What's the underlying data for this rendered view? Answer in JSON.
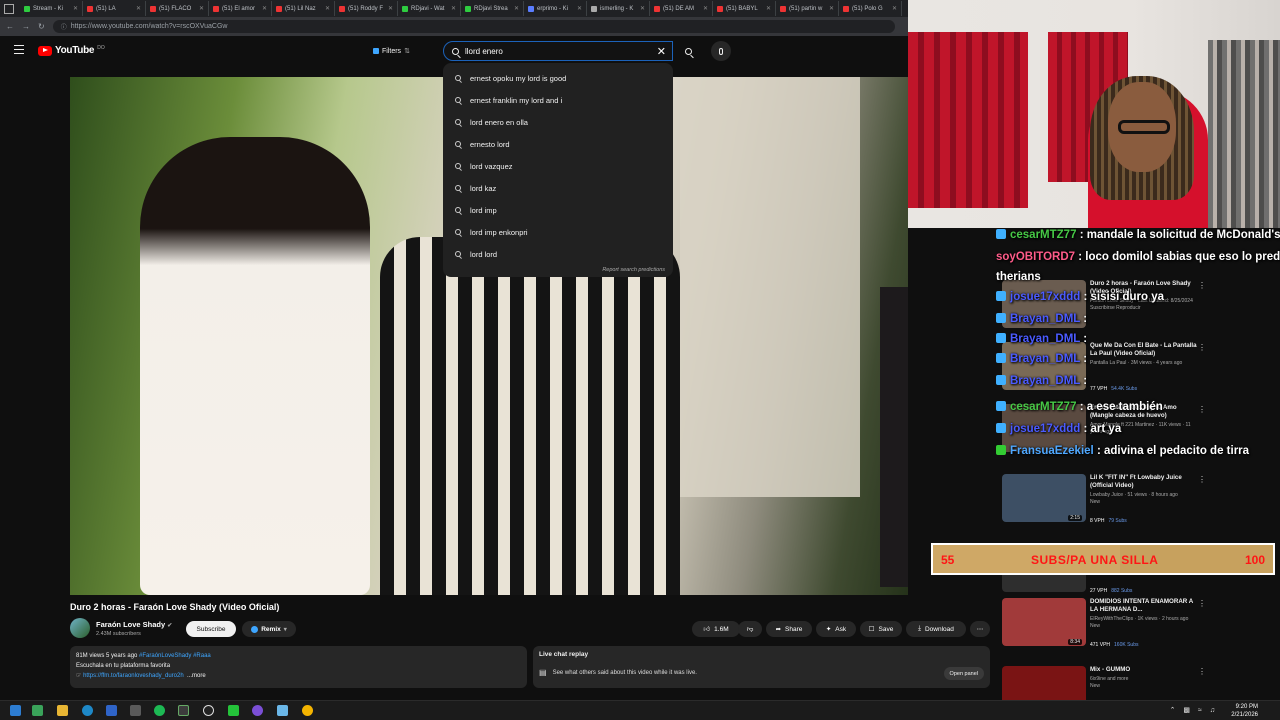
{
  "browser": {
    "tabs": [
      {
        "label": "Stream - Ki",
        "kind": "twitch"
      },
      {
        "label": "(51) LA",
        "kind": "yt"
      },
      {
        "label": "(51) FLACO",
        "kind": "yt"
      },
      {
        "label": "(51) El amor",
        "kind": "yt"
      },
      {
        "label": "(51) Lil Naz",
        "kind": "yt"
      },
      {
        "label": "(51) Roddy F",
        "kind": "yt"
      },
      {
        "label": "RDjavi - Wat",
        "kind": "twitch"
      },
      {
        "label": "RDjavi Strea",
        "kind": "twitch"
      },
      {
        "label": "erprimo - Ki",
        "kind": "blue"
      },
      {
        "label": "ismerling - K",
        "kind": "grey"
      },
      {
        "label": "(51) DE AM",
        "kind": "yt"
      },
      {
        "label": "(51) BABYL",
        "kind": "yt"
      },
      {
        "label": "(51) partin w",
        "kind": "yt"
      },
      {
        "label": "(51) Polo G",
        "kind": "yt"
      }
    ],
    "url": "https://www.youtube.com/watch?v=rscOXVuaCGw"
  },
  "header": {
    "logo_text": "YouTube",
    "logo_sup": "DO",
    "filters_label": "Filters",
    "search_query": "llord enero"
  },
  "suggestions": {
    "items": [
      "ernest opoku my lord is good",
      "ernest franklin my lord and i",
      "lord enero en olla",
      "ernesto lord",
      "lord vazquez",
      "lord kaz",
      "lord imp",
      "lord imp enkonpri",
      "lord lord"
    ],
    "report": "Report search predictions"
  },
  "video": {
    "title": "Duro 2 horas - Faraón Love Shady (Video Oficial)",
    "channel": "Faraón Love Shady",
    "subscribers": "2.43M subscribers",
    "subscribe_label": "Subscribe",
    "remix_label": "Remix",
    "likes": "1.6M",
    "share_label": "Share",
    "ask_label": "Ask",
    "save_label": "Save",
    "download_label": "Download"
  },
  "description": {
    "stats": "81M views  5 years ago",
    "tags": "#FaraónLoveShady #Raaa",
    "line2": "Escuchala en tu plataforma favorita",
    "link": "https://ffm.to/faraonloveshady_duro2h",
    "more": "...more"
  },
  "livechat": {
    "title": "Live chat replay",
    "text": "See what others said about this video while it was live.",
    "button": "Open panel"
  },
  "recommendations": [
    {
      "title": "Duro 2 horas - Faraón Love Shady (Video Oficial)",
      "meta": "Faraón Love Shady · Last Updated: 8/25/2024",
      "extra": "Suscribirse Reproducir",
      "vph": "",
      "views": "",
      "duration": ""
    },
    {
      "title": "Que Me Da Con El Bate - La Pantalla La Paul (Video Oficial)",
      "meta": "Pantalla La Paul · 3M views · 4 years ago",
      "extra": "",
      "vph": "77 VPH",
      "views": "54.4K Subs",
      "duration": ""
    },
    {
      "title": "Ercira Tatafondo: Soy tu Amo (Mangle cabeza de huevo)",
      "meta": "Amor Mangle ft 221 Martinez · 11K views · 11 years ago",
      "extra": "",
      "vph": "",
      "views": "",
      "duration": ""
    },
    {
      "title": "Lil K \"FIT IN\" Ft Lowbaby Juice (Official Video)",
      "meta": "Lowbaby Juice · 51 views · 8 hours ago",
      "extra": "New",
      "vph": "8 VPH",
      "views": "79 Subs",
      "duration": "2:15"
    },
    {
      "title": "REW: EL FALTON",
      "meta": "Ft. Flacocmc, LAJAI and more",
      "extra": "Mix",
      "vph": "27 VPH",
      "views": "882 Subs",
      "duration": ""
    },
    {
      "title": "DOMIDIOS INTENTA ENAMORAR A LA HERMANA D...",
      "meta": "ElReyWithTheClips · 1K views · 2 hours ago",
      "extra": "New",
      "vph": "471 VPH",
      "views": "160K Subs",
      "duration": "8:34"
    },
    {
      "title": "Mix - GUMMO",
      "meta": "6ix9ine and more",
      "extra": "New",
      "vph": "3K VPH",
      "views": "",
      "duration": ""
    }
  ],
  "chat": [
    {
      "user": "cesarMTZ77",
      "text": ": mandale la solicitud de McDonald's",
      "color": "green",
      "badge": "blue"
    },
    {
      "user": "soyOBITORD7",
      "text": ": loco domilol sabias que eso lo predice en las",
      "color": "pink",
      "badge": ""
    },
    {
      "user": "",
      "text": "therians",
      "color": "",
      "badge": ""
    },
    {
      "user": "josue17xddd",
      "text": ": sisisi duro ya",
      "color": "blue",
      "badge": "blue"
    },
    {
      "user": "Brayan_DML",
      "text": ":",
      "color": "blue",
      "badge": "blue"
    },
    {
      "user": "Brayan_DML",
      "text": ":",
      "color": "blue",
      "badge": "blue"
    },
    {
      "user": "Brayan_DML",
      "text": ":",
      "color": "blue",
      "badge": "blue"
    },
    {
      "user": "Brayan_DML",
      "text": ":",
      "color": "blue",
      "badge": "blue"
    },
    {
      "user": "cesarMTZ77",
      "text": ": a ese también",
      "color": "green",
      "badge": "blue"
    },
    {
      "user": "josue17xddd",
      "text": ": art ya",
      "color": "blue",
      "badge": "blue"
    },
    {
      "user": "FransuaEzekiel",
      "text": ": adivina el pedacito de tirra",
      "color": "lblue",
      "badge": "green"
    }
  ],
  "subgoal": {
    "current": "55",
    "label": "SUBS/PA UNA SILLA",
    "target": "100",
    "progress": 0.55
  },
  "taskbar": {
    "time": "9:20 PM",
    "date": "2/21/2026"
  },
  "colors": {
    "yt_red": "#ff0000",
    "goal_bg": "#c7a15e",
    "goal_text": "#ff1515",
    "chat_green": "#46c846",
    "chat_pink": "#ff5c8a",
    "chat_blue": "#4b5bff"
  }
}
